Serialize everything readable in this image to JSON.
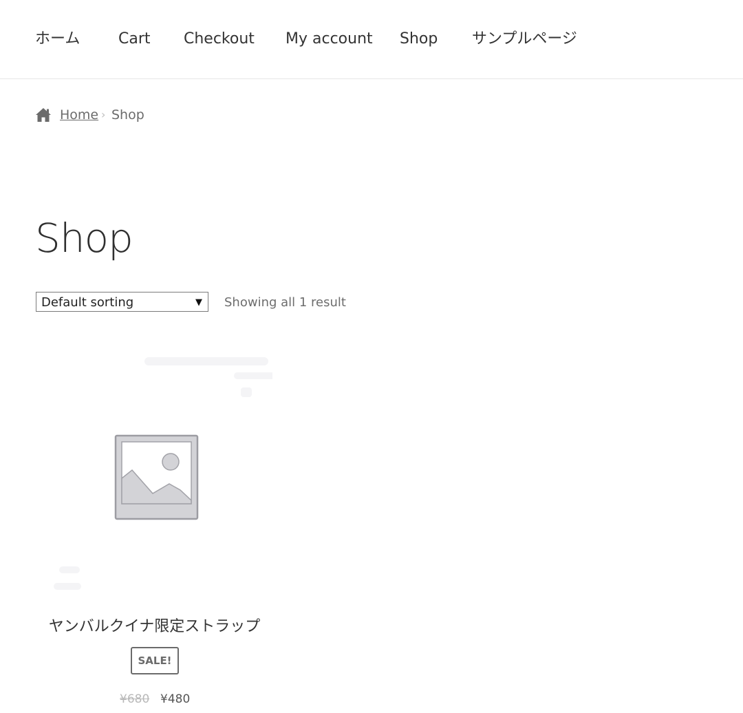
{
  "nav": {
    "items": [
      {
        "label": "ホーム"
      },
      {
        "label": "Cart"
      },
      {
        "label": "Checkout"
      },
      {
        "label": "My account"
      },
      {
        "label": "Shop"
      },
      {
        "label": "サンプルページ"
      }
    ]
  },
  "breadcrumb": {
    "home_label": "Home",
    "separator": "›",
    "current": "Shop"
  },
  "page": {
    "title": "Shop"
  },
  "toolbar": {
    "sort_selected": "Default sorting",
    "sort_arrow": "▼",
    "result_count": "Showing all 1 result"
  },
  "products": [
    {
      "title": "ヤンバルクイナ限定ストラップ",
      "badge": "SALE!",
      "regular_price": "¥680",
      "sale_price": "¥480",
      "image_icon": "image-placeholder-icon"
    }
  ],
  "colors": {
    "text": "#333333",
    "muted": "#6b6b6b",
    "placeholder_gray": "#d2d2d6"
  }
}
